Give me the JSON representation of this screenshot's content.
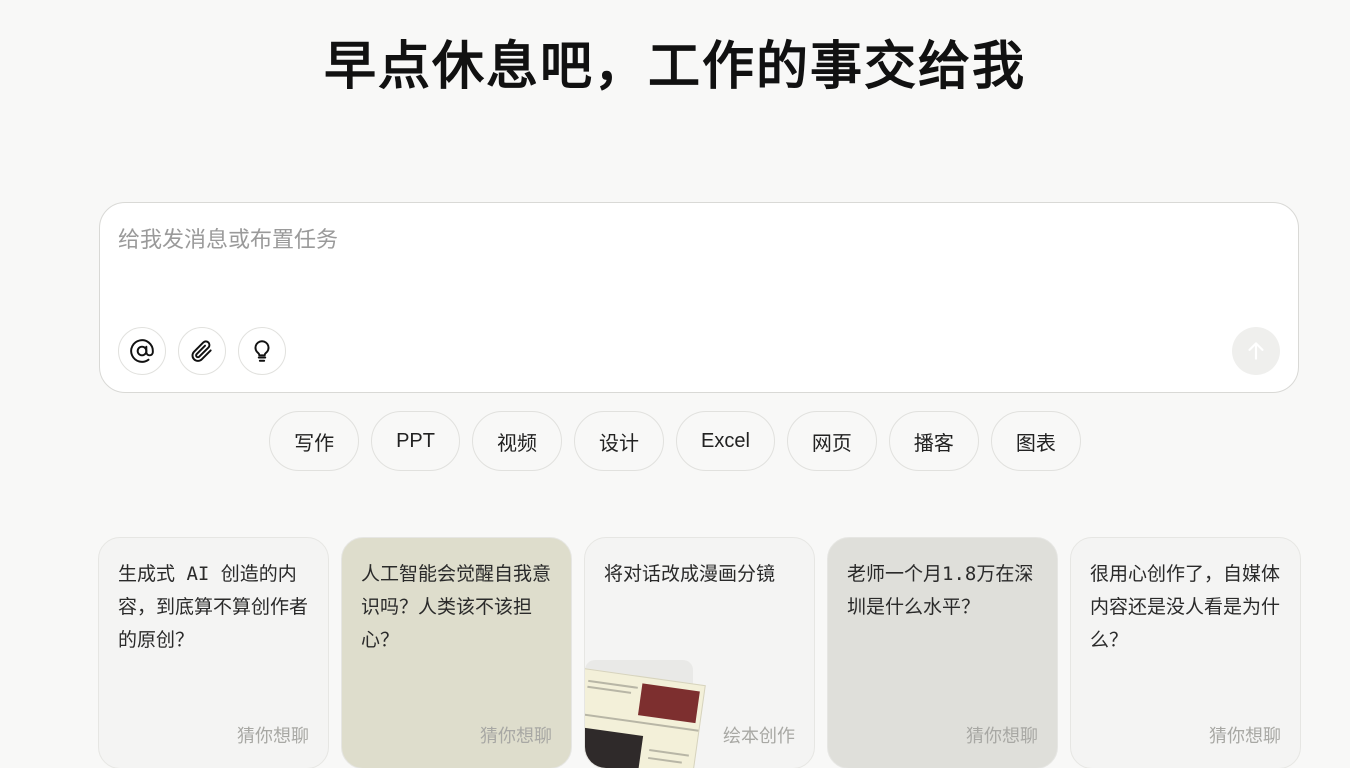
{
  "headline": "早点休息吧，工作的事交给我",
  "composer": {
    "placeholder": "给我发消息或布置任务",
    "tools": [
      {
        "icon": "at-icon"
      },
      {
        "icon": "paperclip-icon"
      },
      {
        "icon": "lightbulb-icon"
      }
    ],
    "send_icon": "arrow-up-icon"
  },
  "chips": [
    "写作",
    "PPT",
    "视频",
    "设计",
    "Excel",
    "网页",
    "播客",
    "图表"
  ],
  "cards": [
    {
      "text": "生成式 AI 创造的内容，到底算不算创作者的原创？",
      "tag": "猜你想聊",
      "bg": "#f4f4f3"
    },
    {
      "text": "人工智能会觉醒自我意识吗？人类该不该担心？",
      "tag": "猜你想聊",
      "bg": "#deddcc"
    },
    {
      "text": "将对话改成漫画分镜",
      "tag": "绘本创作",
      "bg": "#f4f4f3"
    },
    {
      "text": "老师一个月1.8万在深圳是什么水平？",
      "tag": "猜你想聊",
      "bg": "#dfdfda"
    },
    {
      "text": "很用心创作了，自媒体内容还是没人看是为什么？",
      "tag": "猜你想聊",
      "bg": "#f4f4f3"
    }
  ]
}
